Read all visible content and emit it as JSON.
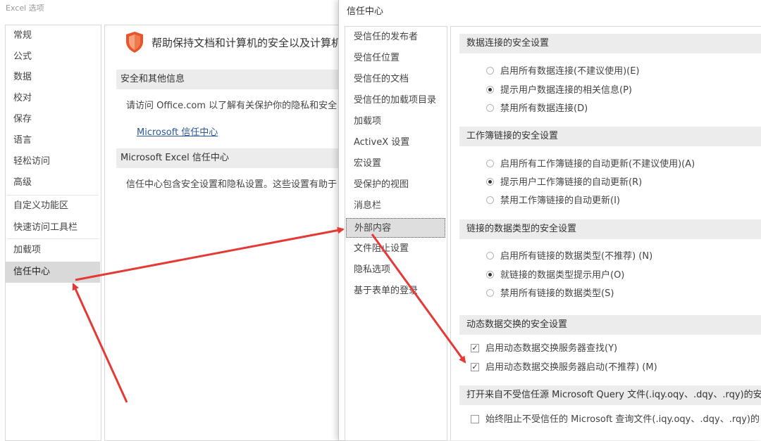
{
  "options_window": {
    "title": "Excel 选项",
    "nav": [
      {
        "label": "常规"
      },
      {
        "label": "公式"
      },
      {
        "label": "数据"
      },
      {
        "label": "校对"
      },
      {
        "label": "保存"
      },
      {
        "label": "语言"
      },
      {
        "label": "轻松访问"
      },
      {
        "label": "高级"
      },
      {
        "label": "自定义功能区"
      },
      {
        "label": "快速访问工具栏"
      },
      {
        "label": "加载项"
      },
      {
        "label": "信任中心",
        "selected": true
      }
    ],
    "heading": "帮助保持文档和计算机的安全以及计算机",
    "section_privacy": "安全和其他信息",
    "privacy_text": "请访问 Office.com 以了解有关保护你的隐私和安全",
    "link": "Microsoft 信任中心",
    "section_trust": "Microsoft Excel 信任中心",
    "trust_text": "信任中心包含安全设置和隐私设置。这些设置有助于"
  },
  "trust_center": {
    "title": "信任中心",
    "nav": [
      {
        "label": "受信任的发布者"
      },
      {
        "label": "受信任位置"
      },
      {
        "label": "受信任的文档"
      },
      {
        "label": "受信任的加载项目录"
      },
      {
        "label": "加载项"
      },
      {
        "label": "ActiveX 设置"
      },
      {
        "label": "宏设置"
      },
      {
        "label": "受保护的视图"
      },
      {
        "label": "消息栏"
      },
      {
        "label": "外部内容",
        "selected": true
      },
      {
        "label": "文件阻止设置"
      },
      {
        "label": "隐私选项"
      },
      {
        "label": "基于表单的登录"
      }
    ],
    "sections": {
      "data_conn": {
        "title": "数据连接的安全设置",
        "options": [
          "启用所有数据连接(不建议使用)(E)",
          "提示用户数据连接的相关信息(P)",
          "禁用所有数据连接(D)"
        ],
        "selected": 1
      },
      "workbook_links": {
        "title": "工作簿链接的安全设置",
        "options": [
          "启用所有工作簿链接的自动更新(不建议使用)(A)",
          "提示用户工作簿链接的自动更新(R)",
          "禁用工作簿链接的自动更新(I)"
        ],
        "selected": 1
      },
      "linked_types": {
        "title": "链接的数据类型的安全设置",
        "options": [
          "启用所有链接的数据类型(不推荐) (N)",
          "就链接的数据类型提示用户(O)",
          "禁用所有链接的数据类型(S)"
        ],
        "selected": 1
      },
      "dde": {
        "title": "动态数据交换的安全设置",
        "checks": [
          "启用动态数据交换服务器查找(Y)",
          "启用动态数据交换服务器启动(不推荐) (M)"
        ]
      },
      "query": {
        "title": "打开来自不受信任源 Microsoft Query 文件(.iqy.oqy、.dqy、.rqy)的安全",
        "check": "始终阻止不受信任的 Microsoft 查询文件(.iqy.oqy、.dqy、.rqy)的"
      }
    }
  },
  "colors": {
    "arrow": "#e53935",
    "link": "#2b579a",
    "shield": "#e8552b",
    "section_bg": "#ececec",
    "selected_bg": "#d9d9d9"
  }
}
